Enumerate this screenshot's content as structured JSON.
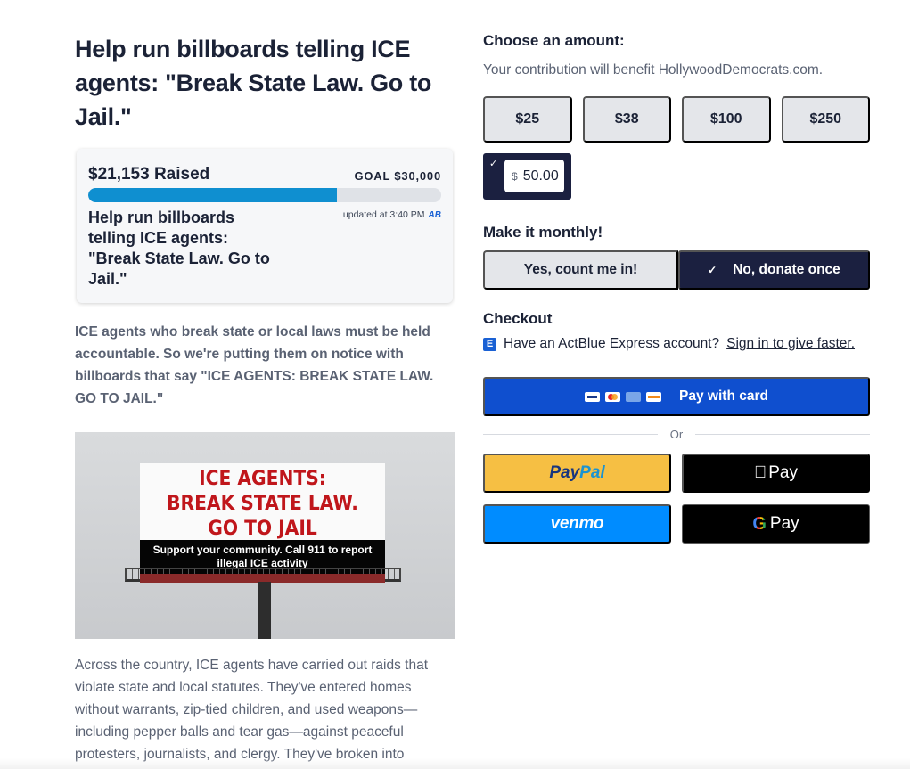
{
  "campaign": {
    "title": "Help run billboards telling ICE agents: \"Break State Law. Go to Jail.\"",
    "progress": {
      "raised": "$21,153 Raised",
      "goal": "GOAL $30,000",
      "percent": 0.705,
      "card_title": "Help run billboards telling ICE agents: \"Break State Law. Go to Jail.\"",
      "updated": "updated at 3:40 PM",
      "logo": "AB"
    },
    "intro": "ICE agents who break state or local laws must be held accountable. So we're putting them on notice with billboards that say \"ICE AGENTS: BREAK STATE LAW. GO TO JAIL.\"",
    "billboard": {
      "line1": "ICE AGENTS:",
      "line2": "BREAK STATE LAW.",
      "line3": "GO TO JAIL",
      "strip": "Support your community. Call 911 to report illegal ICE activity"
    },
    "body": "Across the country, ICE agents have carried out raids that violate state and local statutes. They've entered homes without warrants, zip-tied children, and used weapons—including pepper balls and tear gas—against peaceful protesters, journalists, and clergy. They've broken into"
  },
  "donate": {
    "choose_heading": "Choose an amount:",
    "subtitle": "Your contribution will benefit HollywoodDemocrats.com.",
    "amounts": [
      "$25",
      "$38",
      "$100",
      "$250"
    ],
    "custom": {
      "currency": "$",
      "value": "50.00"
    },
    "monthly_heading": "Make it monthly!",
    "monthly_yes": "Yes, count me in!",
    "monthly_no": "No, donate once",
    "checkout_heading": "Checkout",
    "express_text": "Have an ActBlue Express account?",
    "express_link": "Sign in to give faster.",
    "pay_card": "Pay with card",
    "or": "Or",
    "paypal_a": "Pay",
    "paypal_b": "Pal",
    "applepay": "Pay",
    "venmo": "venmo",
    "gpay": "Pay",
    "colors": {
      "primary": "#0f4fcf",
      "dark": "#1b2040",
      "progress": "#0f8fd0"
    }
  }
}
